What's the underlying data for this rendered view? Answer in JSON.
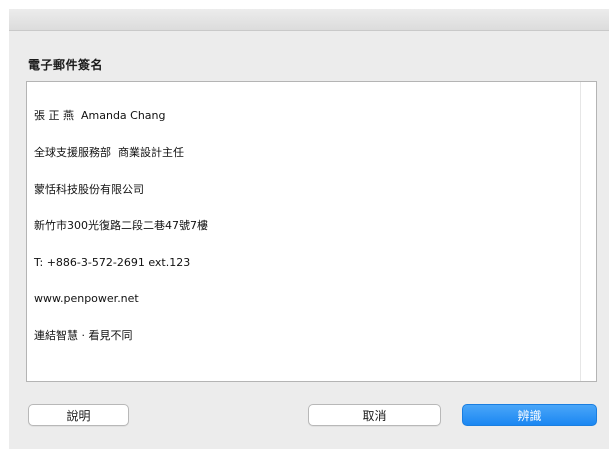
{
  "dialog": {
    "heading": "電子郵件簽名",
    "signature_lines": [
      "張 正 燕  Amanda Chang",
      "全球支援服務部  商業設計主任",
      "蒙恬科技股份有限公司",
      "新竹市300光復路二段二巷47號7樓",
      "T: +886-3-572-2691 ext.123",
      "www.penpower.net",
      "連結智慧 · 看見不同"
    ],
    "buttons": {
      "help_label": "說明",
      "cancel_label": "取消",
      "recognize_label": "辨識"
    }
  },
  "colors": {
    "panel_background": "#ececec",
    "primary_button": "#1b87f2",
    "text_area_border": "#b4b4b4"
  }
}
